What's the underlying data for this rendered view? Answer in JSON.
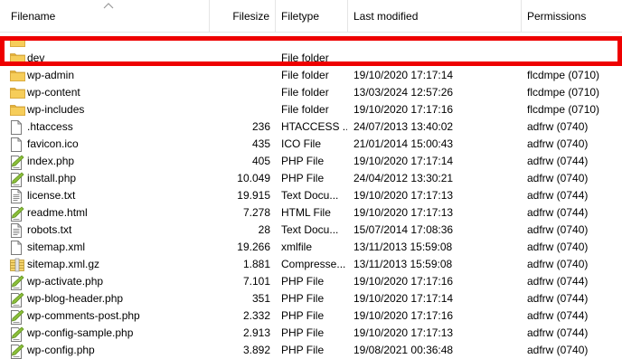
{
  "columns": {
    "filename": "Filename",
    "filesize": "Filesize",
    "filetype": "Filetype",
    "last_modified": "Last modified",
    "permissions": "Permissions"
  },
  "rows": [
    {
      "icon": "folder-icon",
      "name": "",
      "size": "",
      "type": "",
      "modified": "",
      "perms": ""
    },
    {
      "icon": "folder-icon",
      "name": "dev",
      "size": "",
      "type": "File folder",
      "modified": "",
      "perms": ""
    },
    {
      "icon": "folder-icon",
      "name": "wp-admin",
      "size": "",
      "type": "File folder",
      "modified": "19/10/2020 17:17:14",
      "perms": "flcdmpe (0710)"
    },
    {
      "icon": "folder-icon",
      "name": "wp-content",
      "size": "",
      "type": "File folder",
      "modified": "13/03/2024 12:57:26",
      "perms": "flcdmpe (0710)"
    },
    {
      "icon": "folder-icon",
      "name": "wp-includes",
      "size": "",
      "type": "File folder",
      "modified": "19/10/2020 17:17:16",
      "perms": "flcdmpe (0710)"
    },
    {
      "icon": "file-icon",
      "name": ".htaccess",
      "size": "236",
      "type": "HTACCESS ...",
      "modified": "24/07/2013 13:40:02",
      "perms": "adfrw (0740)"
    },
    {
      "icon": "file-icon",
      "name": "favicon.ico",
      "size": "435",
      "type": "ICO File",
      "modified": "21/01/2014 15:00:43",
      "perms": "adfrw (0740)"
    },
    {
      "icon": "php-file-icon",
      "name": "index.php",
      "size": "405",
      "type": "PHP File",
      "modified": "19/10/2020 17:17:14",
      "perms": "adfrw (0744)"
    },
    {
      "icon": "php-file-icon",
      "name": "install.php",
      "size": "10.049",
      "type": "PHP File",
      "modified": "24/04/2012 13:30:21",
      "perms": "adfrw (0740)"
    },
    {
      "icon": "text-file-icon",
      "name": "license.txt",
      "size": "19.915",
      "type": "Text Docu...",
      "modified": "19/10/2020 17:17:13",
      "perms": "adfrw (0744)"
    },
    {
      "icon": "php-file-icon",
      "name": "readme.html",
      "size": "7.278",
      "type": "HTML File",
      "modified": "19/10/2020 17:17:13",
      "perms": "adfrw (0744)"
    },
    {
      "icon": "text-file-icon",
      "name": "robots.txt",
      "size": "28",
      "type": "Text Docu...",
      "modified": "15/07/2014 17:08:36",
      "perms": "adfrw (0740)"
    },
    {
      "icon": "file-icon",
      "name": "sitemap.xml",
      "size": "19.266",
      "type": "xmlfile",
      "modified": "13/11/2013 15:59:08",
      "perms": "adfrw (0740)"
    },
    {
      "icon": "archive-file-icon",
      "name": "sitemap.xml.gz",
      "size": "1.881",
      "type": "Compresse...",
      "modified": "13/11/2013 15:59:08",
      "perms": "adfrw (0740)"
    },
    {
      "icon": "php-file-icon",
      "name": "wp-activate.php",
      "size": "7.101",
      "type": "PHP File",
      "modified": "19/10/2020 17:17:16",
      "perms": "adfrw (0744)"
    },
    {
      "icon": "php-file-icon",
      "name": "wp-blog-header.php",
      "size": "351",
      "type": "PHP File",
      "modified": "19/10/2020 17:17:14",
      "perms": "adfrw (0744)"
    },
    {
      "icon": "php-file-icon",
      "name": "wp-comments-post.php",
      "size": "2.332",
      "type": "PHP File",
      "modified": "19/10/2020 17:17:16",
      "perms": "adfrw (0744)"
    },
    {
      "icon": "php-file-icon",
      "name": "wp-config-sample.php",
      "size": "2.913",
      "type": "PHP File",
      "modified": "19/10/2020 17:17:13",
      "perms": "adfrw (0744)"
    },
    {
      "icon": "php-file-icon",
      "name": "wp-config.php",
      "size": "3.892",
      "type": "PHP File",
      "modified": "19/08/2021 00:36:48",
      "perms": "adfrw (0740)"
    }
  ],
  "highlighted_row": "dev",
  "colors": {
    "highlight": "#ee0000",
    "folder": "#f6cd5a",
    "php_leaf": "#8bbf3a"
  }
}
